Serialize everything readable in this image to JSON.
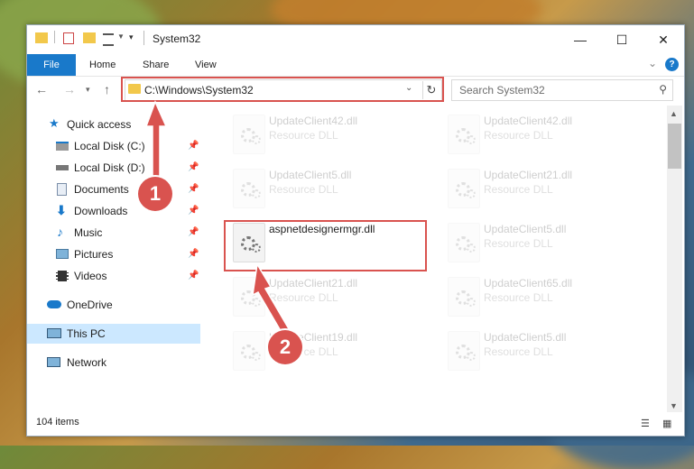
{
  "window": {
    "title": "System32",
    "controls": {
      "minimize": "—",
      "maximize": "☐",
      "close": "✕"
    }
  },
  "ribbon": {
    "file_label": "File",
    "tabs": [
      "Home",
      "Share",
      "View"
    ]
  },
  "address": {
    "path": "C:\\Windows\\System32",
    "search_placeholder": "Search System32"
  },
  "nav": {
    "quick_access": "Quick access",
    "pinned": [
      "Local Disk (C:)",
      "Local Disk (D:)",
      "Documents",
      "Downloads",
      "Music",
      "Pictures",
      "Videos"
    ],
    "onedrive": "OneDrive",
    "this_pc": "This PC",
    "network": "Network"
  },
  "files": [
    {
      "name": "UpdateClient42.dll",
      "desc": "Resource DLL"
    },
    {
      "name": "UpdateClient42.dll",
      "desc": "Resource DLL"
    },
    {
      "name": "UpdateClient5.dll",
      "desc": "Resource DLL"
    },
    {
      "name": "UpdateClient21.dll",
      "desc": "Resource DLL"
    },
    {
      "name": "aspnetdesignermgr.dll",
      "desc": ""
    },
    {
      "name": "UpdateClient5.dll",
      "desc": "Resource DLL"
    },
    {
      "name": "UpdateClient21.dll",
      "desc": "Resource DLL"
    },
    {
      "name": "UpdateClient65.dll",
      "desc": "Resource DLL"
    },
    {
      "name": "UpdateClient19.dll",
      "desc": "Resource DLL"
    },
    {
      "name": "UpdateClient5.dll",
      "desc": "Resource DLL"
    }
  ],
  "status": {
    "items": "104 items"
  },
  "callouts": [
    "1",
    "2"
  ],
  "colors": {
    "accent": "#1979ca",
    "highlight": "#d9534f",
    "selected": "#cce8ff"
  }
}
